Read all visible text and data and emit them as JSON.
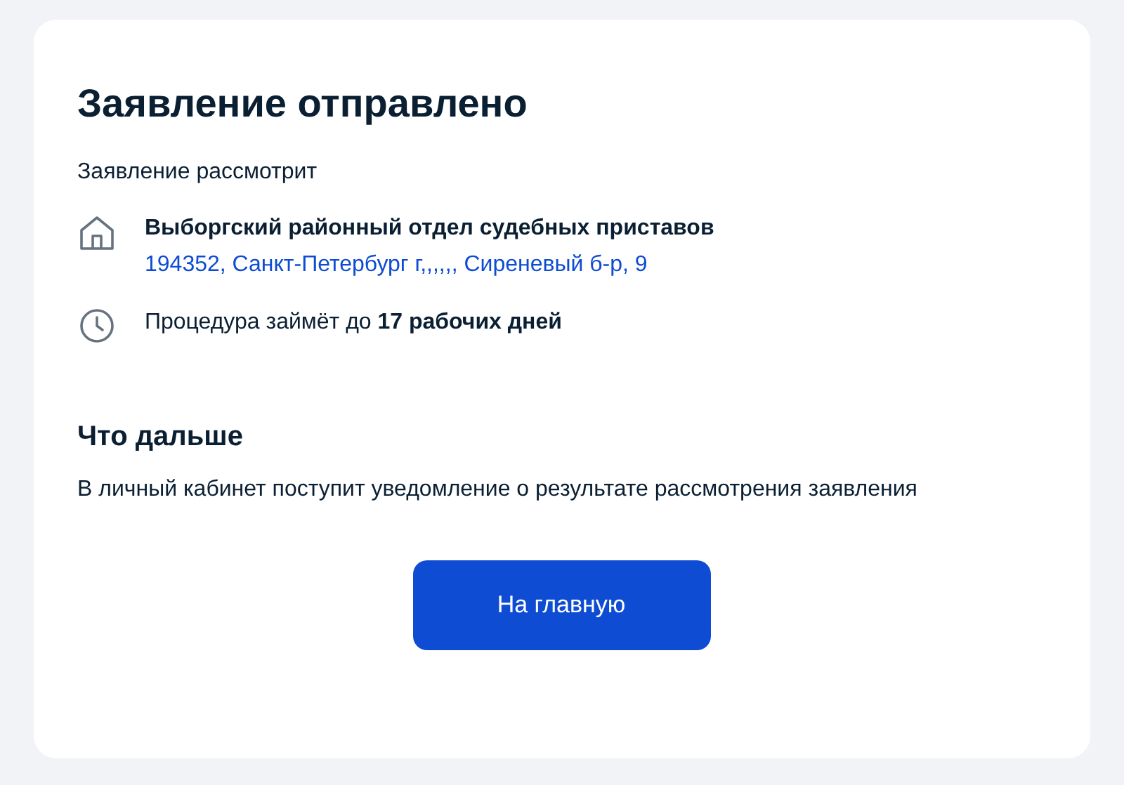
{
  "title": "Заявление отправлено",
  "reviewer_label": "Заявление рассмотрит",
  "details": [
    {
      "kind": "organization",
      "name": "Выборгский районный отдел судебных приставов",
      "address": "194352, Санкт-Петербург г,,,,,, Сиреневый б-р, 9"
    },
    {
      "kind": "duration",
      "text": "Процедура займёт до **17 рабочих дней**"
    }
  ],
  "next": {
    "heading": "Что дальше",
    "text": "В личный кабинет поступит уведомление о результате рассмотрения заявления"
  },
  "button": "На главную"
}
